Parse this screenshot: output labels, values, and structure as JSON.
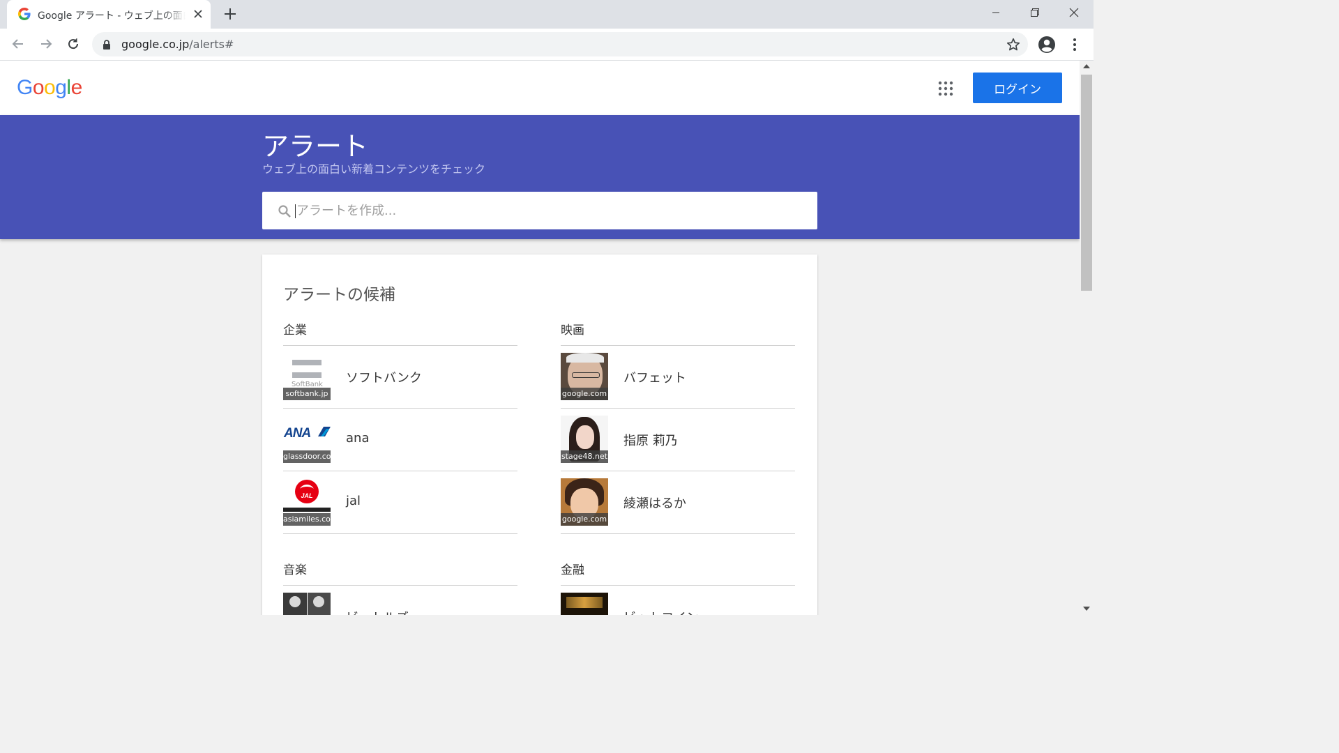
{
  "browser": {
    "tab_title": "Google アラート - ウェブ上の面白い新着コンテンツをチェック",
    "url_domain": "google.co.jp",
    "url_path": "/alerts#"
  },
  "header": {
    "logo_text": "Google",
    "login_label": "ログイン"
  },
  "hero": {
    "title": "アラート",
    "subtitle": "ウェブ上の面白い新着コンテンツをチェック",
    "search_placeholder": "アラートを作成..."
  },
  "suggestions": {
    "title": "アラートの候補",
    "categories": [
      {
        "label": "企業",
        "items": [
          {
            "name": "ソフトバンク",
            "source": "softbank.jp"
          },
          {
            "name": "ana",
            "source": "glassdoor.com"
          },
          {
            "name": "jal",
            "source": "asiamiles.com"
          }
        ]
      },
      {
        "label": "映画",
        "items": [
          {
            "name": "バフェット",
            "source": "google.com"
          },
          {
            "name": "指原 莉乃",
            "source": "stage48.net"
          },
          {
            "name": "綾瀬はるか",
            "source": "google.com"
          }
        ]
      },
      {
        "label": "音楽",
        "items": [
          {
            "name": "ビートルズ",
            "source": ""
          }
        ]
      },
      {
        "label": "金融",
        "items": [
          {
            "name": "ビットコイン",
            "source": ""
          }
        ]
      }
    ]
  },
  "logo_text_images": {
    "softbank": "SoftBank",
    "ana": "ANA",
    "jal": "JAL"
  }
}
